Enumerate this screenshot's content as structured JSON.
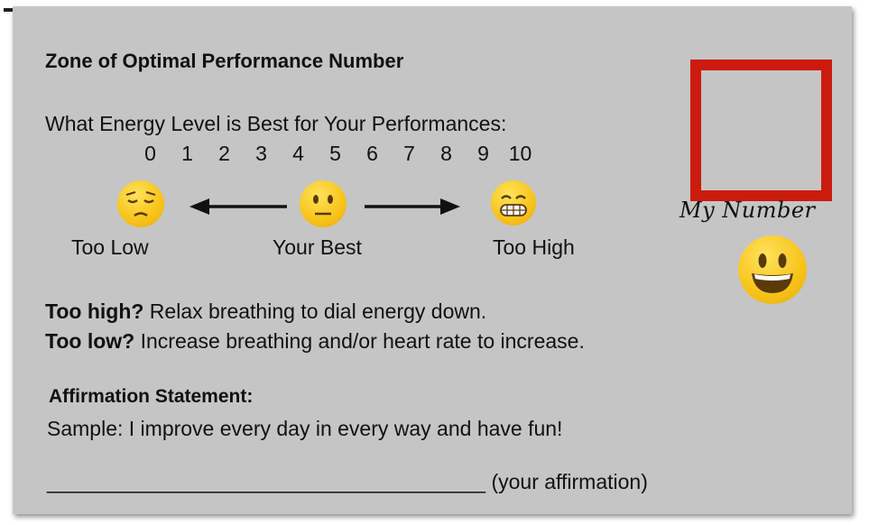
{
  "title": "Zone of Optimal Performance Number",
  "question": "What Energy Level is Best for Your Performances:",
  "scale": [
    "0",
    "1",
    "2",
    "3",
    "4",
    "5",
    "6",
    "7",
    "8",
    "9",
    "10"
  ],
  "faces": {
    "low_label": "Too Low",
    "best_label": "Your Best",
    "high_label": "Too High",
    "low_icon": "pensive-face-icon",
    "best_icon": "neutral-face-icon",
    "high_icon": "grimacing-face-icon"
  },
  "tips": {
    "high_bold": "Too high?",
    "high_text": " Relax breathing to dial energy down.",
    "low_bold": "Too low?",
    "low_text": " Increase breathing and/or heart rate to increase."
  },
  "affirmation": {
    "heading": "Affirmation Statement:",
    "sample": "Sample: I improve every day in every way and have fun!",
    "blank": "______________________________________",
    "suffix": " (your affirmation)"
  },
  "number_box": {
    "label": "My Number",
    "box_color": "#cc1a0f",
    "icon": "smiley-face-icon"
  },
  "colors": {
    "card": "#c5c5c5",
    "emoji": "#f7c31a"
  }
}
